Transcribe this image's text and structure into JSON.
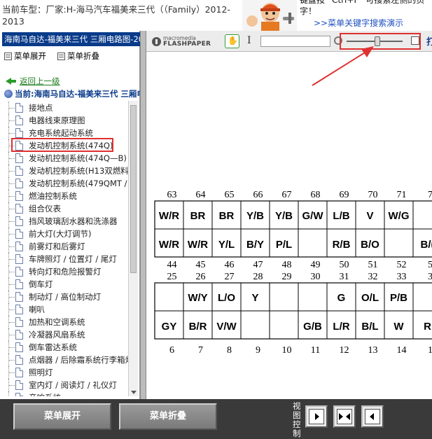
{
  "header": {
    "car_title": "当前车型：厂家:H-海马汽车福美来三代（（Family）2012-2013",
    "tip_line1": "键盘按 “Ctrl+F” 可搜索左侧的页",
    "tip_line2": "字！",
    "demo_link": ">>菜单关键字搜索演示"
  },
  "sidebar": {
    "title": "海南马自达-福美来三代 三厢电路图-20",
    "expand_label": "菜单展开",
    "collapse_label": "菜单折叠",
    "back_label": "返回上一级",
    "current_label": "当前:海南马自达-福美来三代 三厢电",
    "items": [
      "接地点",
      "电器线束原理图",
      "充电系统起动系统",
      "发动机控制系统(474Q)",
      "发动机控制系统(474Q—B)",
      "发动机控制系统(H13双燃料",
      "发动机控制系统(479QMT /",
      "燃油控制系统",
      "组合仪表",
      "挡风玻璃刮水器和洗涤器",
      "前大灯(大灯调节)",
      "前雾灯和后雾灯",
      "车牌照灯 / 位置灯 / 尾灯",
      "转向灯和危险报警灯",
      "倒车灯",
      "制动灯 / 高位制动灯",
      "喇叭",
      "加热和空调系统",
      "冷凝器风扇系统",
      "倒车雷达系统",
      "点烟器 / 后除霜系统行李箱灯",
      "照明灯",
      "室内灯 / 阅读灯 / 礼仪灯",
      "音响系统"
    ],
    "selected_index": 3
  },
  "viewer": {
    "logo_top": "macromedia",
    "logo_bottom": "FLASHPAPER",
    "extra_icon": "打",
    "zoom_level": 0.55
  },
  "connector": {
    "row1_pins": [
      "63",
      "64",
      "65",
      "66",
      "67",
      "68",
      "69",
      "70",
      "71",
      "7"
    ],
    "row1_top": [
      "W/R",
      "BR",
      "BR",
      "Y/B",
      "Y/B",
      "G/W",
      "L/B",
      "V",
      "W/G",
      ""
    ],
    "row1_bottom": [
      "W/R",
      "W/R",
      "Y/L",
      "B/Y",
      "P/L",
      "",
      "R/B",
      "B/O",
      "",
      "B/("
    ],
    "row2_pins": [
      "44",
      "45",
      "46",
      "47",
      "48",
      "49",
      "50",
      "51",
      "52",
      "5"
    ],
    "row3_pins": [
      "25",
      "26",
      "27",
      "28",
      "29",
      "30",
      "31",
      "32",
      "33",
      "3"
    ],
    "row2_top": [
      "",
      "W/Y",
      "L/O",
      "Y",
      "",
      "",
      "G",
      "O/L",
      "P/B",
      ""
    ],
    "row2_bottom": [
      "GY",
      "B/R",
      "V/W",
      "",
      "",
      "G/B",
      "L/R",
      "B/L",
      "W",
      "R"
    ],
    "row4_pins": [
      "6",
      "7",
      "8",
      "9",
      "10",
      "11",
      "12",
      "13",
      "14",
      "1"
    ]
  },
  "footer": {
    "expand_label": "菜单展开",
    "collapse_label": "菜单折叠",
    "view_label": "视图控制"
  }
}
